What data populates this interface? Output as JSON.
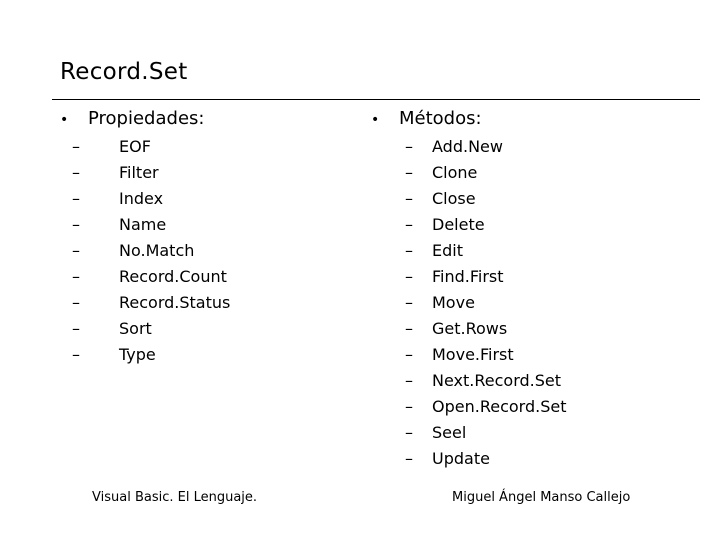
{
  "slide": {
    "title": "Record.Set",
    "left_column": {
      "bullet": "•",
      "heading": "Propiedades:",
      "dash": "–",
      "items": [
        "EOF",
        "Filter",
        "Index",
        "Name",
        "No.Match",
        "Record.Count",
        "Record.Status",
        "Sort",
        "Type"
      ]
    },
    "right_column": {
      "bullet": "•",
      "heading": "Métodos:",
      "dash": "–",
      "items": [
        "Add.New",
        "Clone",
        "Close",
        "Delete",
        "Edit",
        "Find.First",
        "Move",
        "Get.Rows",
        "Move.First",
        "Next.Record.Set",
        "Open.Record.Set",
        "Seel",
        "Update"
      ]
    },
    "footer": {
      "left": "Visual Basic. El Lenguaje.",
      "right": "Miguel Ángel Manso Callejo"
    }
  }
}
